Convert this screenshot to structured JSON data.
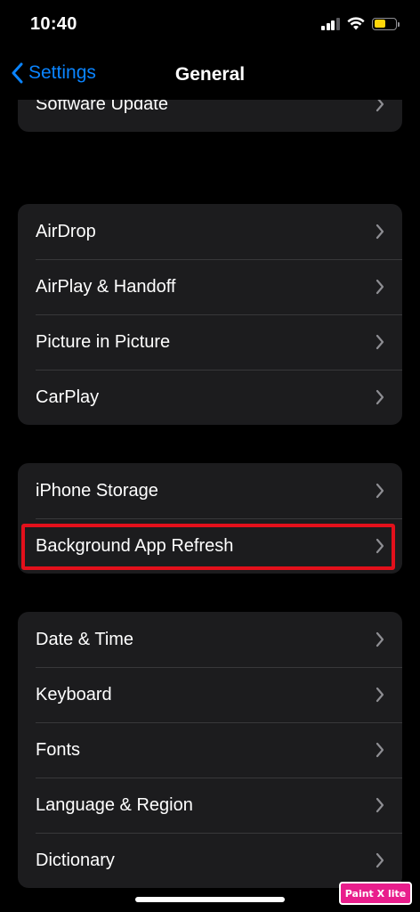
{
  "status_bar": {
    "time": "10:40",
    "battery_color": "#ffd60a"
  },
  "nav": {
    "back_label": "Settings",
    "title": "General",
    "accent_color": "#0a84ff"
  },
  "groups": [
    {
      "items": [
        {
          "label": "Software Update"
        }
      ]
    },
    {
      "items": [
        {
          "label": "AirDrop"
        },
        {
          "label": "AirPlay & Handoff"
        },
        {
          "label": "Picture in Picture"
        },
        {
          "label": "CarPlay"
        }
      ]
    },
    {
      "items": [
        {
          "label": "iPhone Storage"
        },
        {
          "label": "Background App Refresh",
          "highlighted": true
        }
      ]
    },
    {
      "items": [
        {
          "label": "Date & Time"
        },
        {
          "label": "Keyboard"
        },
        {
          "label": "Fonts"
        },
        {
          "label": "Language & Region"
        },
        {
          "label": "Dictionary"
        }
      ]
    }
  ],
  "highlight_color": "#e3101b",
  "watermark": {
    "text": "Paint X lite"
  }
}
